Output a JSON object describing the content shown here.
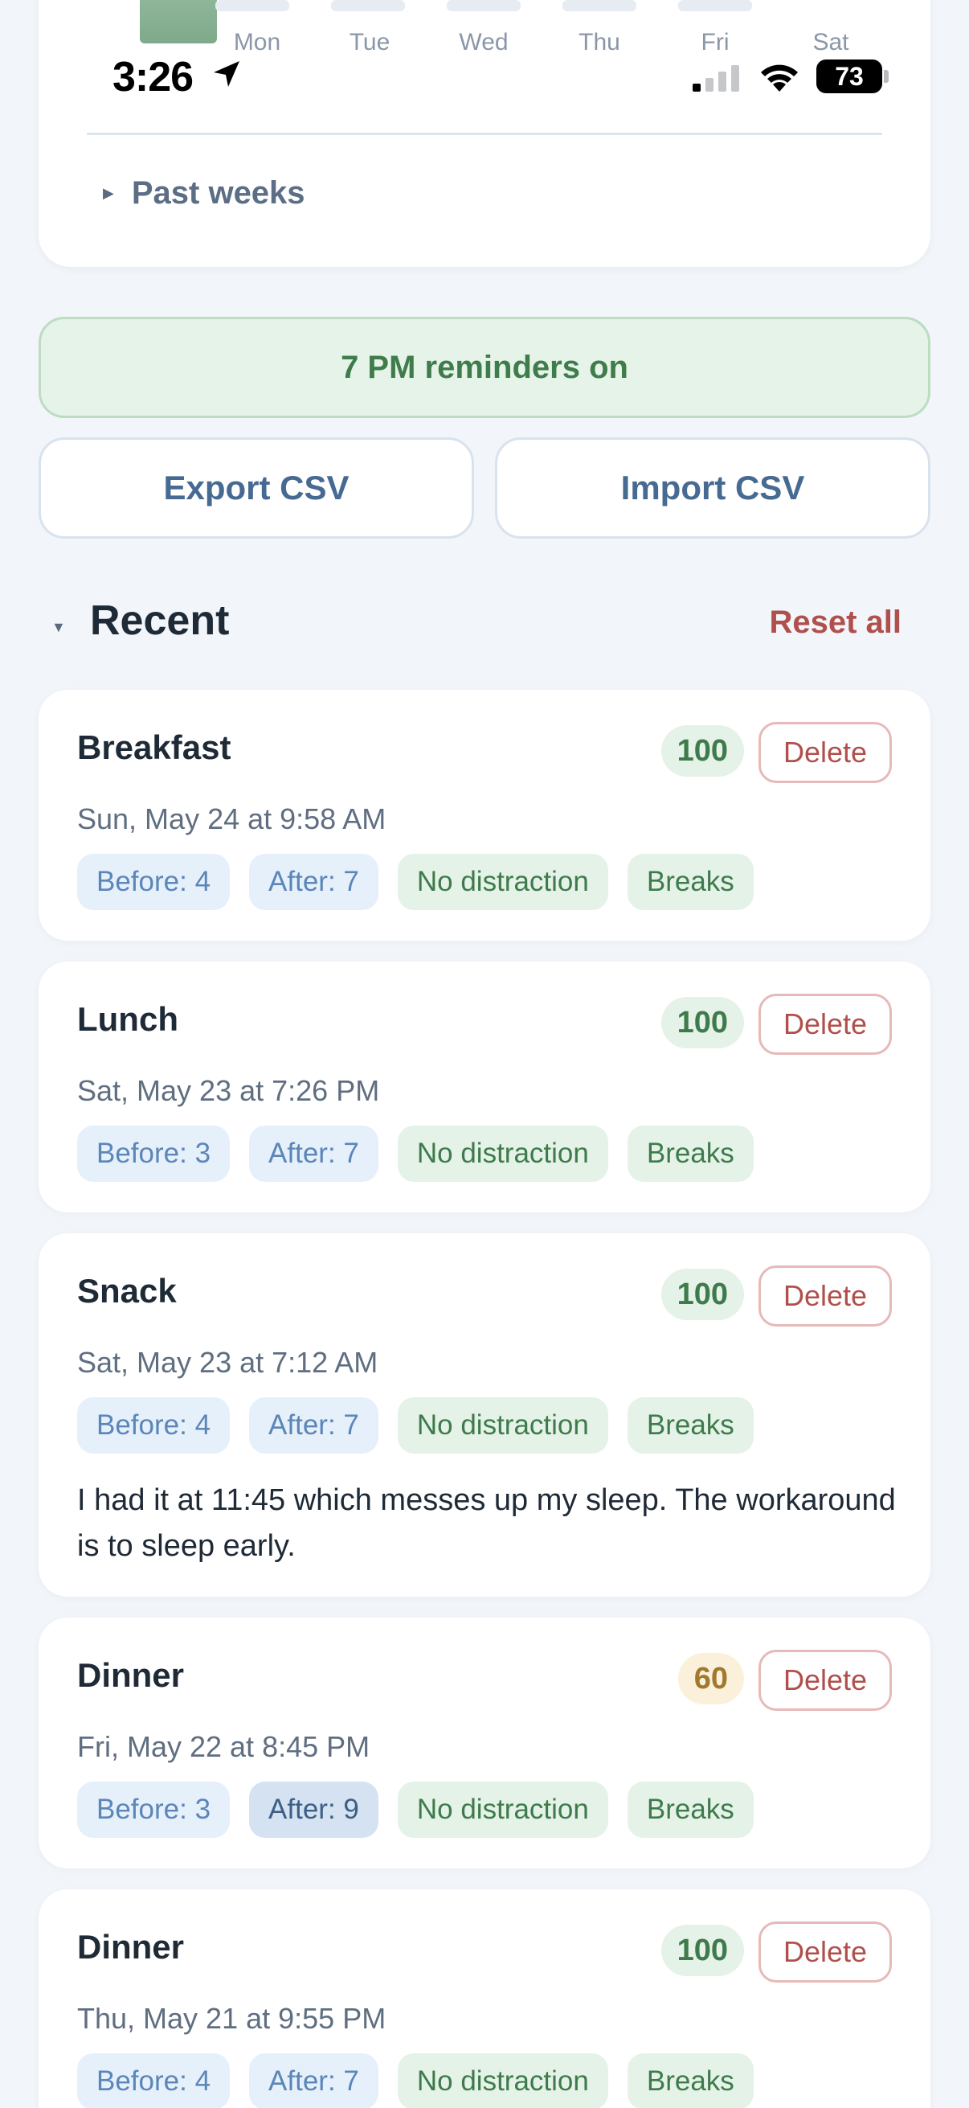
{
  "status_bar": {
    "time": "3:26",
    "battery": "73"
  },
  "weekly_chart": {
    "days": [
      "Mon",
      "Tue",
      "Wed",
      "Thu",
      "Fri",
      "Sat"
    ],
    "past_weeks_label": "Past weeks"
  },
  "actions": {
    "reminder_label": "7 PM reminders on",
    "export_label": "Export CSV",
    "import_label": "Import CSV"
  },
  "recent": {
    "title": "Recent",
    "reset_label": "Reset all",
    "delete_label": "Delete",
    "meals": [
      {
        "name": "Breakfast",
        "date": "Sun, May 24 at 9:58 AM",
        "score": "100",
        "before": "Before: 4",
        "after": "After: 7",
        "tag1": "No distraction",
        "tag2": "Breaks"
      },
      {
        "name": "Lunch",
        "date": "Sat, May 23 at 7:26 PM",
        "score": "100",
        "before": "Before: 3",
        "after": "After: 7",
        "tag1": "No distraction",
        "tag2": "Breaks"
      },
      {
        "name": "Snack",
        "date": "Sat, May 23 at 7:12 AM",
        "score": "100",
        "before": "Before: 4",
        "after": "After: 7",
        "tag1": "No distraction",
        "tag2": "Breaks",
        "note": "I had it at 11:45 which messes up my sleep. The workaround is to sleep early."
      },
      {
        "name": "Dinner",
        "date": "Fri, May 22 at 8:45 PM",
        "score": "60",
        "before": "Before: 3",
        "after": "After: 9",
        "tag1": "No distraction",
        "tag2": "Breaks"
      },
      {
        "name": "Dinner",
        "date": "Thu, May 21 at 9:55 PM",
        "score": "100",
        "before": "Before: 4",
        "after": "After: 7",
        "tag1": "No distraction",
        "tag2": "Breaks"
      }
    ]
  }
}
